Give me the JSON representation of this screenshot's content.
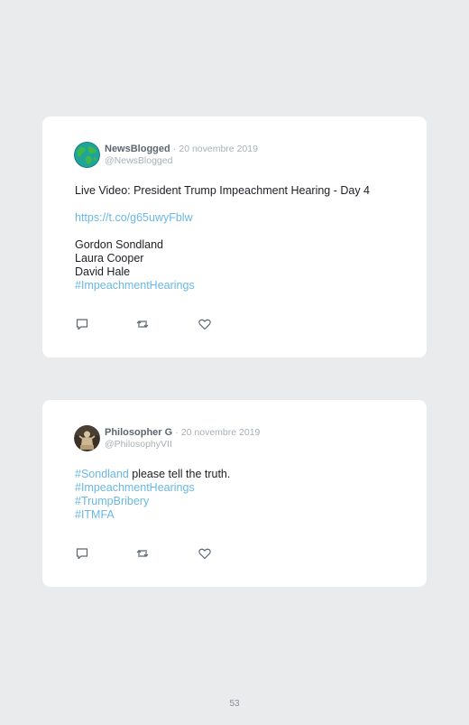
{
  "tweets": [
    {
      "display_name": "NewsBlogged",
      "separator": "·",
      "date": "20 novembre 2019",
      "handle": "@NewsBlogged",
      "avatar_icon": "globe-icon",
      "lines": [
        "Live Video: President Trump Impeachment Hearing - Day 4",
        "https://t.co/g65uwyFblw",
        "Gordon Sondland",
        "Laura Cooper",
        "David Hale",
        "#ImpeachmentHearings"
      ]
    },
    {
      "display_name": "Philosopher G",
      "separator": "·",
      "date": "20 novembre 2019",
      "handle": "@PhilosophyVII",
      "avatar_icon": "statue-icon",
      "lines": [
        "#Sondland",
        " please tell the truth.",
        "#ImpeachmentHearings",
        "#TrumpBribery",
        "#ITMFA"
      ]
    }
  ],
  "action_icons": [
    "reply-icon",
    "retweet-icon",
    "like-icon"
  ],
  "colors": {
    "background": "#e9ebed",
    "card": "#ffffff",
    "link": "#6ab8e4",
    "muted": "#a9b0b6"
  },
  "page_number": "53"
}
